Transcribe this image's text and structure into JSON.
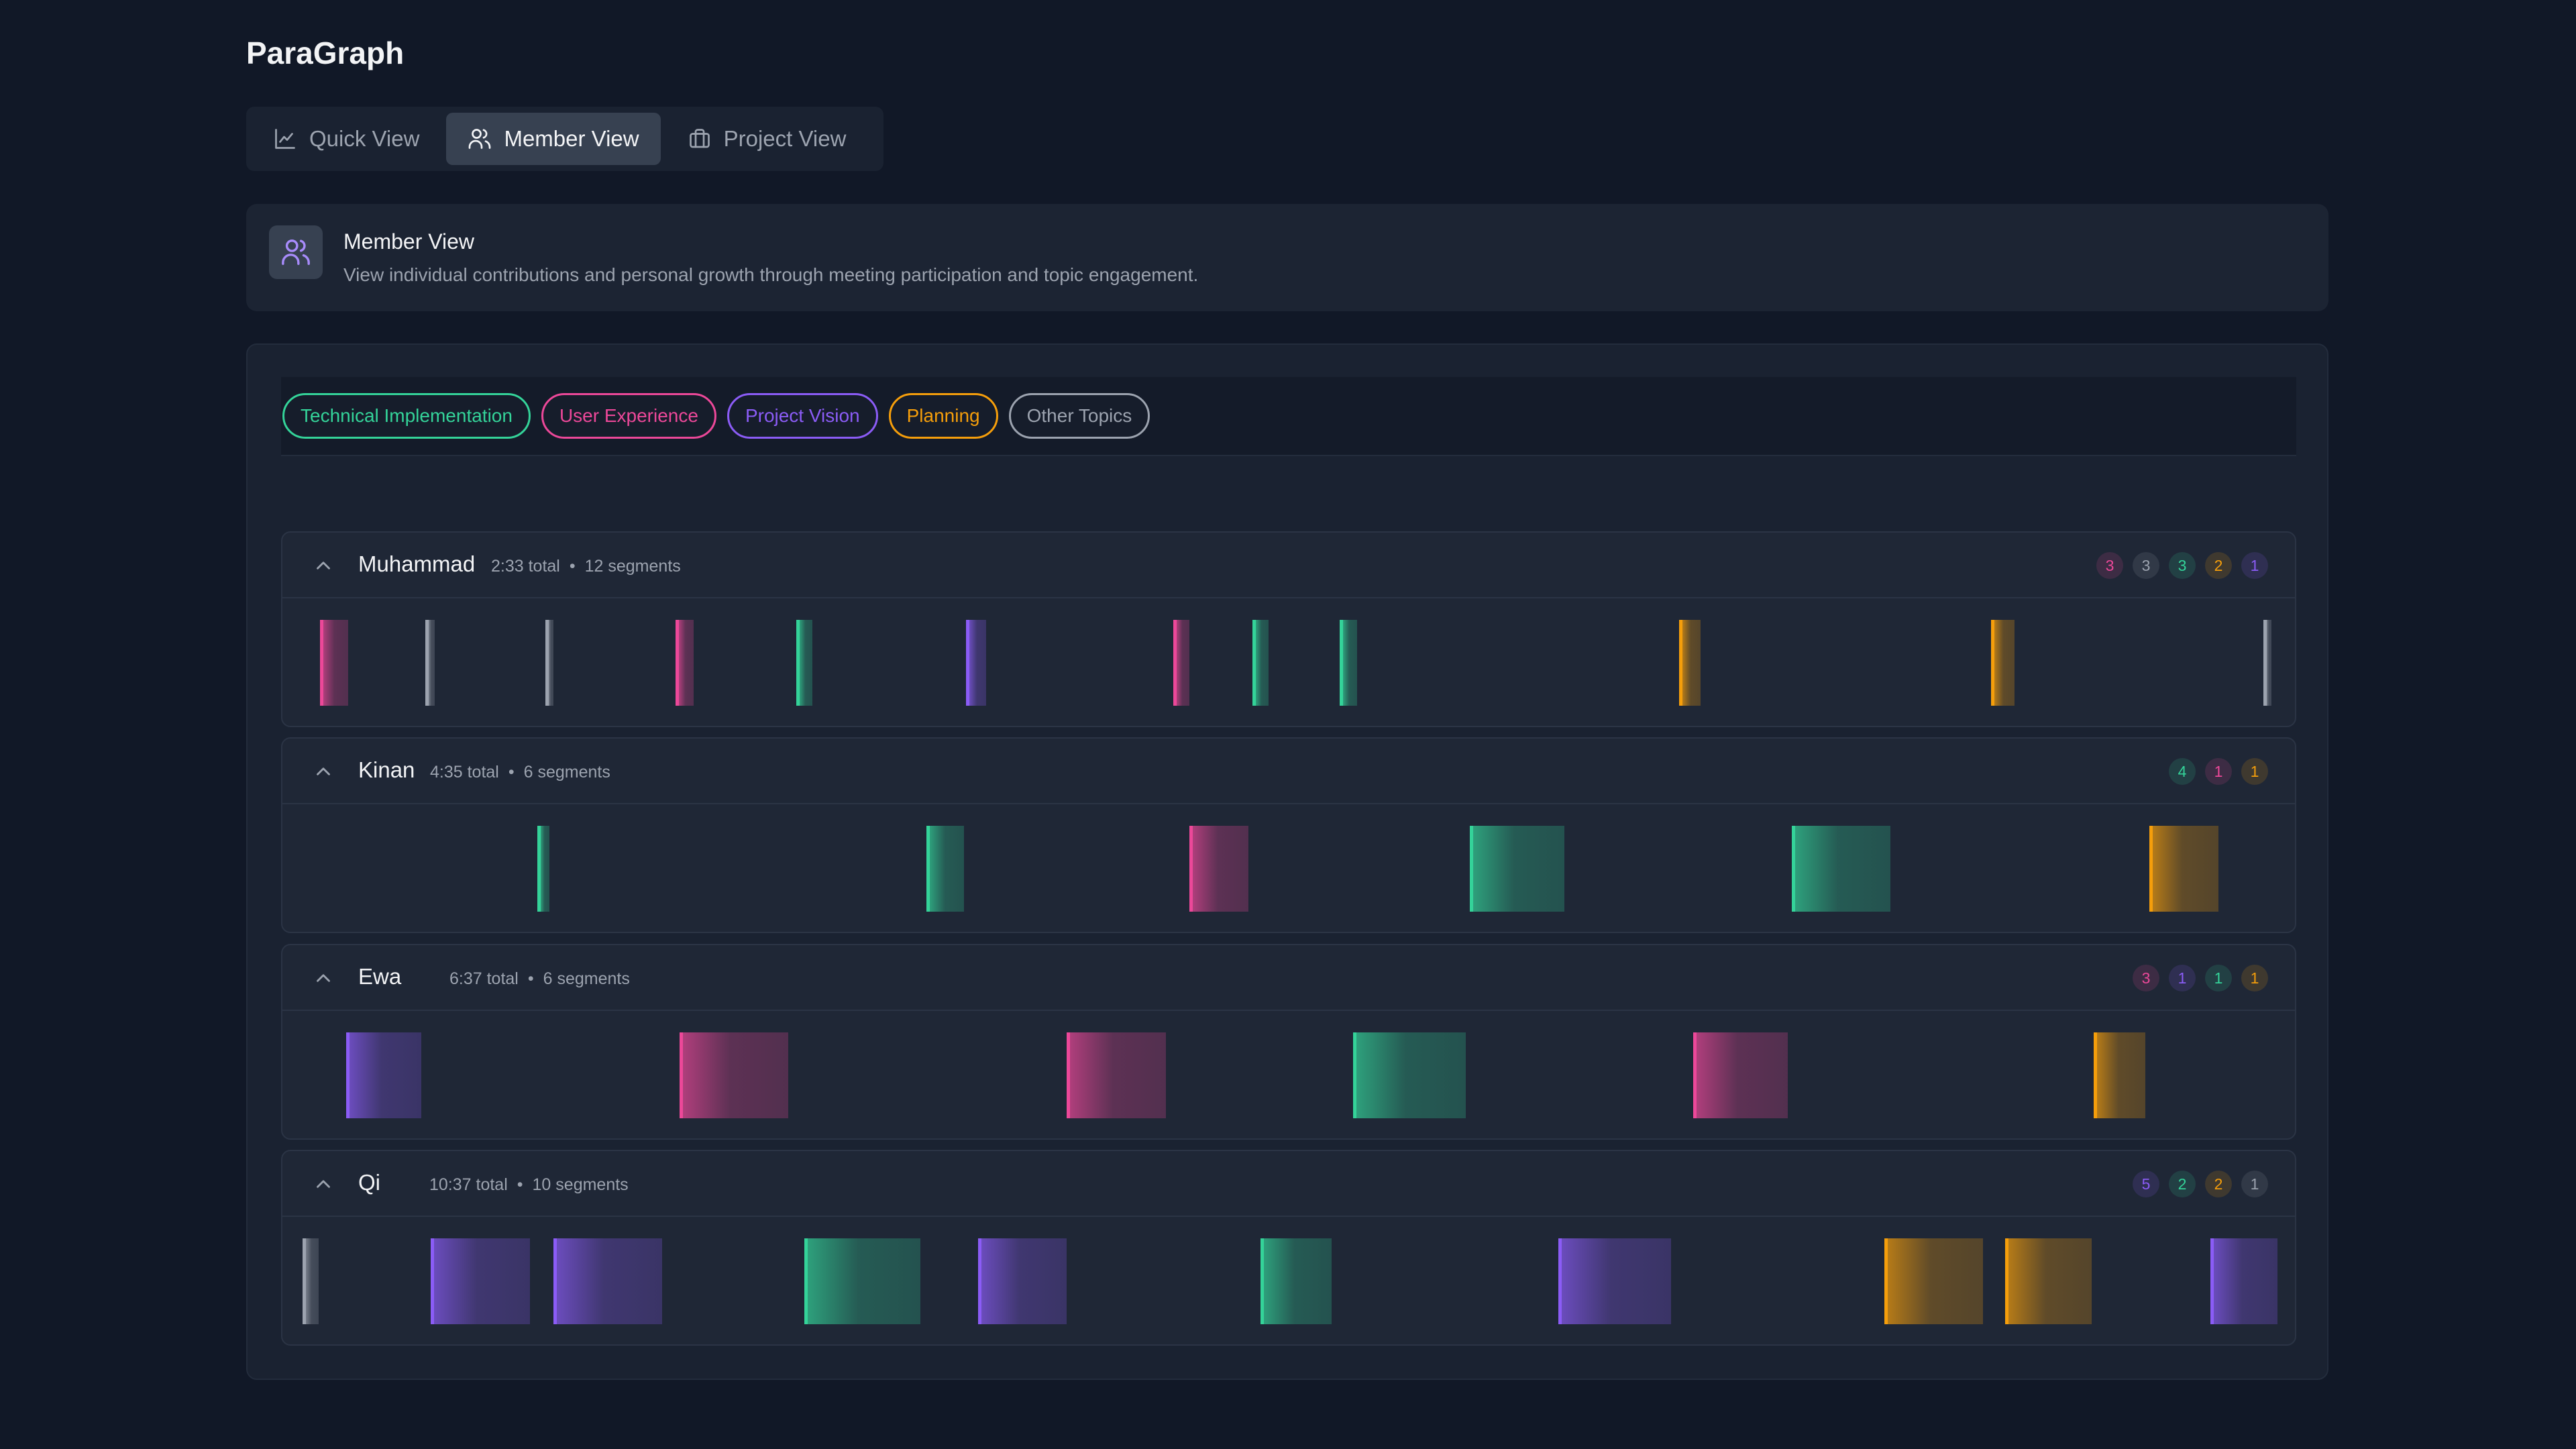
{
  "app": {
    "title": "ParaGraph"
  },
  "tabs": [
    {
      "label": "Quick View",
      "icon": "chart-icon",
      "active": false
    },
    {
      "label": "Member View",
      "icon": "users-icon",
      "active": true
    },
    {
      "label": "Project View",
      "icon": "briefcase-icon",
      "active": false
    }
  ],
  "info": {
    "title": "Member View",
    "description": "View individual contributions and personal growth through meeting participation and topic engagement."
  },
  "topics": [
    {
      "label": "Technical Implementation",
      "color": "#34d399"
    },
    {
      "label": "User Experience",
      "color": "#ec4899"
    },
    {
      "label": "Project Vision",
      "color": "#8b5cf6"
    },
    {
      "label": "Planning",
      "color": "#f59e0b"
    },
    {
      "label": "Other Topics",
      "color": "#9ca3af"
    }
  ],
  "members": [
    {
      "name": "Muhammad",
      "total": "2:33 total",
      "segments_label": "12 segments",
      "badges": [
        {
          "value": "3",
          "topic": 1
        },
        {
          "value": "3",
          "topic": 4
        },
        {
          "value": "3",
          "topic": 0
        },
        {
          "value": "2",
          "topic": 3
        },
        {
          "value": "1",
          "topic": 2
        }
      ],
      "segments": [
        {
          "topic": 1,
          "start": 0.009,
          "duration": 0.014
        },
        {
          "topic": 4,
          "start": 0.062,
          "duration": 0.005
        },
        {
          "topic": 4,
          "start": 0.123,
          "duration": 0.004
        },
        {
          "topic": 1,
          "start": 0.189,
          "duration": 0.009
        },
        {
          "topic": 0,
          "start": 0.25,
          "duration": 0.008
        },
        {
          "topic": 2,
          "start": 0.336,
          "duration": 0.01
        },
        {
          "topic": 1,
          "start": 0.441,
          "duration": 0.008
        },
        {
          "topic": 0,
          "start": 0.481,
          "duration": 0.008
        },
        {
          "topic": 0,
          "start": 0.525,
          "duration": 0.009
        },
        {
          "topic": 3,
          "start": 0.697,
          "duration": 0.011
        },
        {
          "topic": 3,
          "start": 0.855,
          "duration": 0.012
        },
        {
          "topic": 4,
          "start": 0.993,
          "duration": 0.004
        }
      ]
    },
    {
      "name": "Kinan",
      "total": "4:35 total",
      "segments_label": "6 segments",
      "badges": [
        {
          "value": "4",
          "topic": 0
        },
        {
          "value": "1",
          "topic": 1
        },
        {
          "value": "1",
          "topic": 3
        }
      ],
      "segments": [
        {
          "topic": 0,
          "start": 0.119,
          "duration": 0.006
        },
        {
          "topic": 0,
          "start": 0.316,
          "duration": 0.019
        },
        {
          "topic": 1,
          "start": 0.449,
          "duration": 0.03
        },
        {
          "topic": 0,
          "start": 0.591,
          "duration": 0.048
        },
        {
          "topic": 0,
          "start": 0.754,
          "duration": 0.05
        },
        {
          "topic": 3,
          "start": 0.935,
          "duration": 0.035
        }
      ]
    },
    {
      "name": "Ewa",
      "total": "6:37 total",
      "segments_label": "6 segments",
      "badges": [
        {
          "value": "3",
          "topic": 1
        },
        {
          "value": "1",
          "topic": 2
        },
        {
          "value": "1",
          "topic": 0
        },
        {
          "value": "1",
          "topic": 3
        }
      ],
      "segments": [
        {
          "topic": 2,
          "start": 0.022,
          "duration": 0.038
        },
        {
          "topic": 1,
          "start": 0.191,
          "duration": 0.055
        },
        {
          "topic": 1,
          "start": 0.387,
          "duration": 0.05
        },
        {
          "topic": 0,
          "start": 0.532,
          "duration": 0.057
        },
        {
          "topic": 1,
          "start": 0.704,
          "duration": 0.048
        },
        {
          "topic": 3,
          "start": 0.907,
          "duration": 0.026
        }
      ]
    },
    {
      "name": "Qi",
      "total": "10:37 total",
      "segments_label": "10 segments",
      "badges": [
        {
          "value": "5",
          "topic": 2
        },
        {
          "value": "2",
          "topic": 0
        },
        {
          "value": "2",
          "topic": 3
        },
        {
          "value": "1",
          "topic": 4
        }
      ],
      "segments": [
        {
          "topic": 4,
          "start": 0.0,
          "duration": 0.008
        },
        {
          "topic": 2,
          "start": 0.065,
          "duration": 0.05
        },
        {
          "topic": 2,
          "start": 0.127,
          "duration": 0.055
        },
        {
          "topic": 0,
          "start": 0.254,
          "duration": 0.059
        },
        {
          "topic": 2,
          "start": 0.342,
          "duration": 0.045
        },
        {
          "topic": 0,
          "start": 0.485,
          "duration": 0.036
        },
        {
          "topic": 2,
          "start": 0.636,
          "duration": 0.057
        },
        {
          "topic": 3,
          "start": 0.801,
          "duration": 0.05
        },
        {
          "topic": 3,
          "start": 0.862,
          "duration": 0.044
        },
        {
          "topic": 2,
          "start": 0.966,
          "duration": 0.034
        }
      ]
    }
  ]
}
